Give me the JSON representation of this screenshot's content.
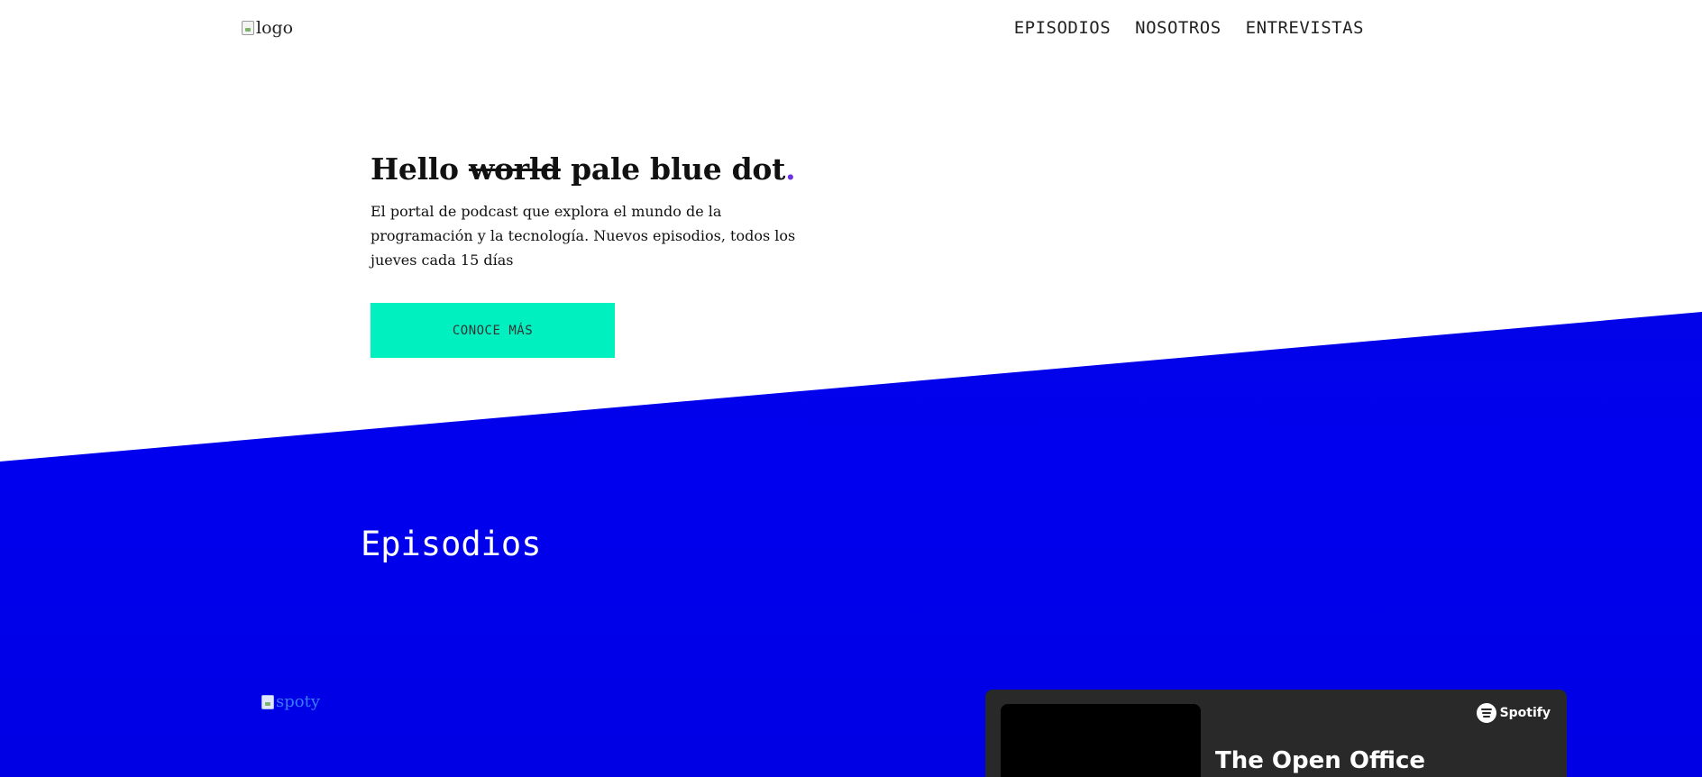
{
  "header": {
    "logo_alt": "logo",
    "nav": [
      {
        "label": "EPISODIOS"
      },
      {
        "label": "NOSOTROS"
      },
      {
        "label": "ENTREVISTAS"
      }
    ]
  },
  "hero": {
    "title_hello": "Hello ",
    "title_strike": "world",
    "title_rest": " pale blue dot",
    "title_dot": ".",
    "subtitle": "El portal de podcast que explora el mundo de la programación y la tecnología. Nuevos episodios, todos los jueves cada 15 días",
    "cta_label": "CONOCE MÁS"
  },
  "episodes": {
    "section_title": "Episodios",
    "spoty_alt": "spoty",
    "player": {
      "brand": "Spotify",
      "episode_title": "The Open Office"
    }
  },
  "colors": {
    "accent_cta": "#00f0c0",
    "band_blue": "#0000ee",
    "player_bg": "#292929",
    "title_dot": "#6d35e0"
  }
}
